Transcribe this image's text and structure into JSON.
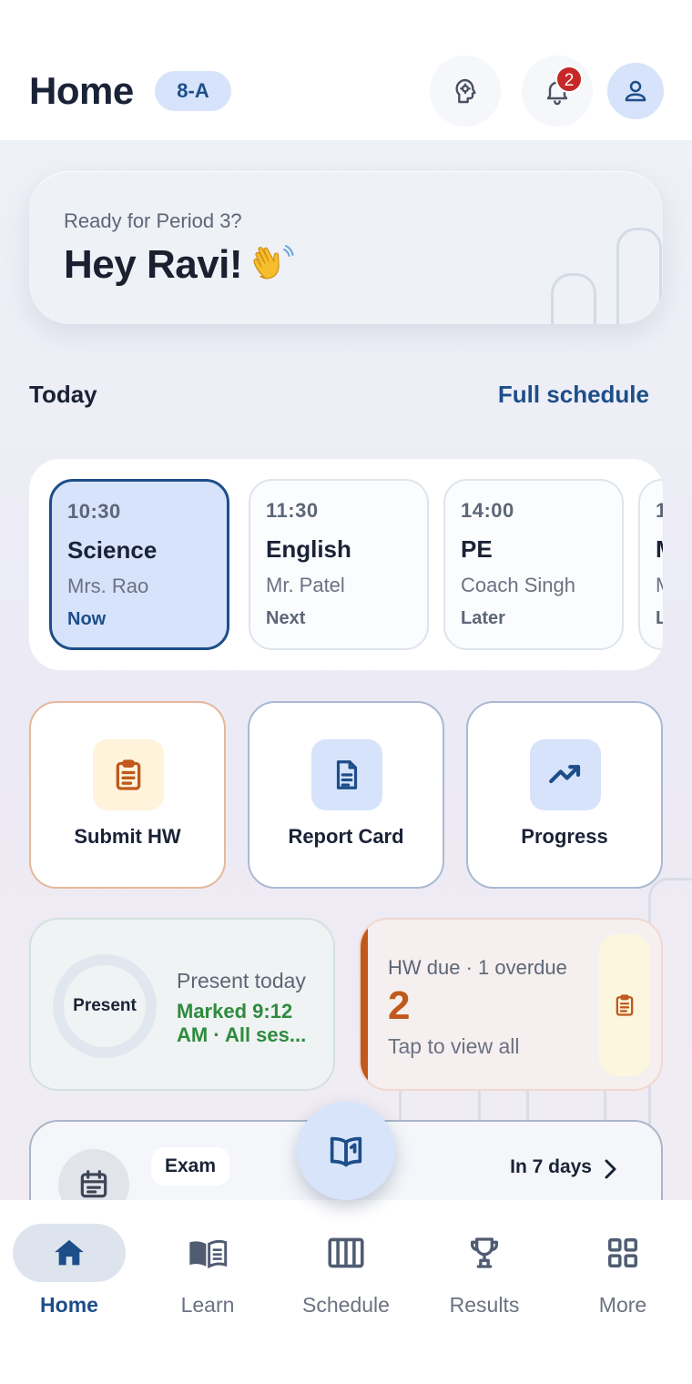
{
  "header": {
    "title": "Home",
    "class_badge": "8-A",
    "notification_count": "2"
  },
  "hero": {
    "subtitle": "Ready for Period 3?",
    "greeting": "Hey Ravi!",
    "emoji": "👋"
  },
  "today": {
    "title": "Today",
    "link": "Full schedule",
    "periods": [
      {
        "time": "10:30",
        "subject": "Science",
        "teacher": "Mrs. Rao",
        "status": "Now",
        "active": true
      },
      {
        "time": "11:30",
        "subject": "English",
        "teacher": "Mr. Patel",
        "status": "Next"
      },
      {
        "time": "14:00",
        "subject": "PE",
        "teacher": "Coach Singh",
        "status": "Later"
      },
      {
        "time": "1",
        "subject": "M",
        "teacher": "M",
        "status": "L"
      }
    ]
  },
  "actions": [
    {
      "label": "Submit HW",
      "icon": "clipboard-icon"
    },
    {
      "label": "Report Card",
      "icon": "document-icon"
    },
    {
      "label": "Progress",
      "icon": "trending-up-icon"
    }
  ],
  "attendance": {
    "ring_label": "Present",
    "title": "Present today",
    "detail": "Marked 9:12 AM · All ses..."
  },
  "homework": {
    "title": "HW due · 1 overdue",
    "count": "2",
    "hint": "Tap to view all"
  },
  "exam": {
    "tag": "Exam",
    "when": "In 7 days"
  },
  "nav": [
    {
      "label": "Home",
      "icon": "home-icon",
      "active": true
    },
    {
      "label": "Learn",
      "icon": "book-icon"
    },
    {
      "label": "Schedule",
      "icon": "schedule-icon"
    },
    {
      "label": "Results",
      "icon": "trophy-icon"
    },
    {
      "label": "More",
      "icon": "grid-icon"
    }
  ],
  "colors": {
    "primary": "#1d4e89",
    "accent_light": "#d6e3fb",
    "homework_accent": "#c0591b",
    "attendance_green": "#2e8b3e",
    "badge_red": "#c62828"
  }
}
